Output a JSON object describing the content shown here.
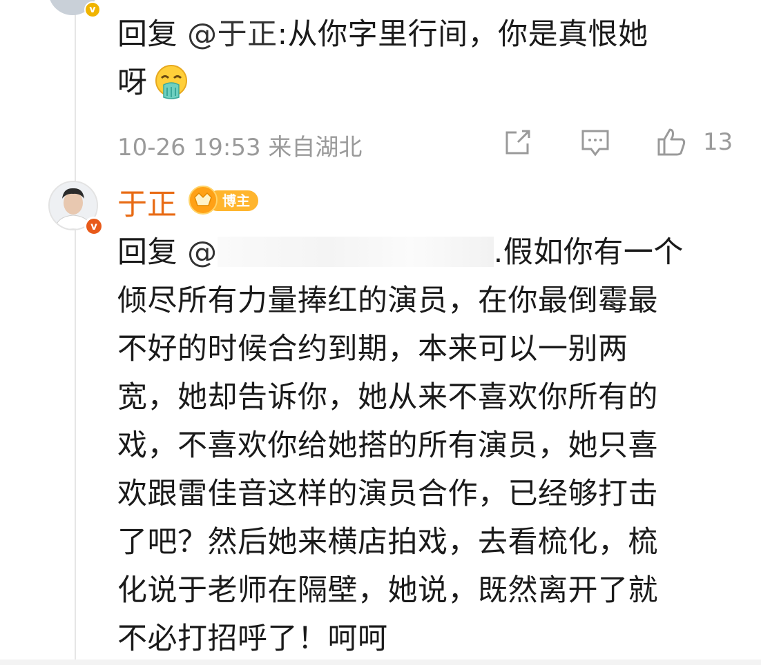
{
  "comment1": {
    "reply_prefix": "回复",
    "mention": "@于正",
    "line1_rest": ":从你字里行间，你是真恨她",
    "line2": "呀",
    "emoji_icon": "vomit-emoji-icon",
    "timestamp": "10-26 19:53",
    "location": "来自湖北",
    "like_count": "13"
  },
  "comment2": {
    "username": "于正",
    "badge_label": "博主",
    "reply_prefix": "回复",
    "mention": "@",
    "line1_rest": ".假如你有一个",
    "lines": [
      "倾尽所有力量捧红的演员，在你最倒霉最",
      "不好的时候合约到期，本来可以一别两",
      "宽，她却告诉你，她从来不喜欢你所有的",
      "戏，不喜欢你给她搭的所有演员，她只喜",
      "欢跟雷佳音这样的演员合作，已经够打击",
      "了吧？然后她来横店拍戏，去看梳化，梳",
      "化说于老师在隔壁，她说，既然离开了就",
      "不必打招呼了！呵呵"
    ]
  },
  "colors": {
    "username": "#e86b14",
    "meta": "#9a9a9a",
    "text": "#1a1a1a"
  }
}
